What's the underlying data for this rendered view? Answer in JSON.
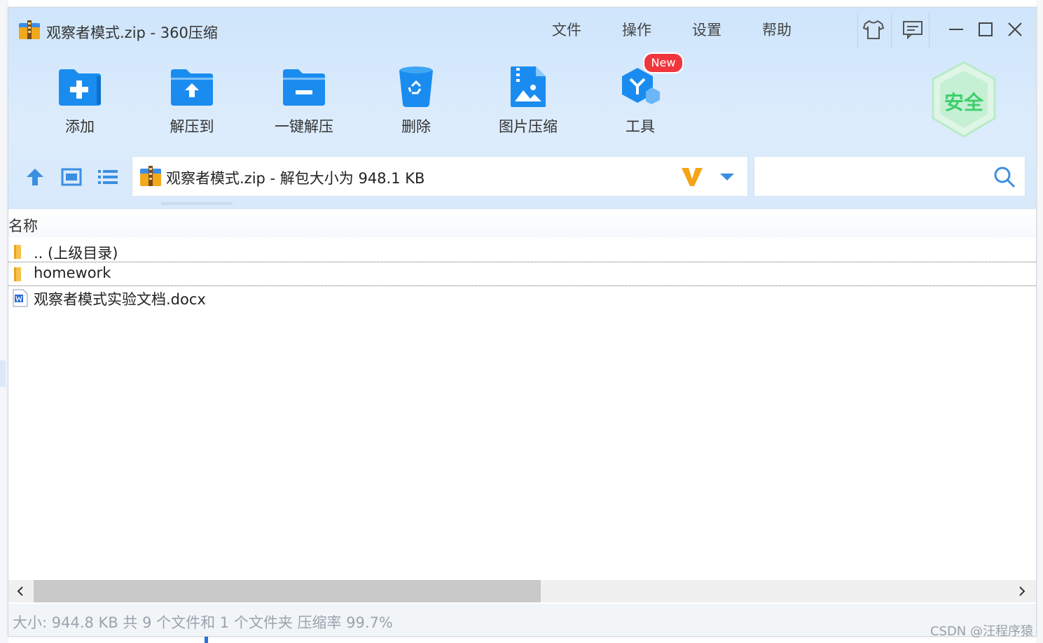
{
  "window": {
    "title": "观察者模式.zip - 360压缩"
  },
  "menu": {
    "items": [
      "文件",
      "操作",
      "设置",
      "帮助"
    ]
  },
  "toolbar": {
    "buttons": [
      {
        "label": "添加",
        "icon": "add-folder-icon"
      },
      {
        "label": "解压到",
        "icon": "extract-to-folder-icon"
      },
      {
        "label": "一键解压",
        "icon": "one-click-extract-icon"
      },
      {
        "label": "删除",
        "icon": "recycle-bin-icon"
      },
      {
        "label": "图片压缩",
        "icon": "image-compress-icon"
      },
      {
        "label": "工具",
        "icon": "tools-cube-icon"
      }
    ],
    "new_badge": "New",
    "security_label": "安全"
  },
  "pathbar": {
    "text": "观察者模式.zip - 解包大小为 948.1 KB"
  },
  "search": {
    "placeholder": ""
  },
  "filelist": {
    "column_header": "名称",
    "rows": [
      {
        "name": ".. (上级目录)",
        "type": "folder"
      },
      {
        "name": "homework",
        "type": "folder",
        "selected": true
      },
      {
        "name": "观察者模式实验文档.docx",
        "type": "docx"
      }
    ]
  },
  "status": {
    "text": "大小: 944.8 KB 共 9 个文件和 1 个文件夹 压缩率 99.7%"
  },
  "watermark": "CSDN @汪程序猿",
  "colors": {
    "accent": "#1a8cf0",
    "header_bg": "#d7e9fb",
    "security_green": "#3fcf6c",
    "badge_red": "#f0363d"
  }
}
